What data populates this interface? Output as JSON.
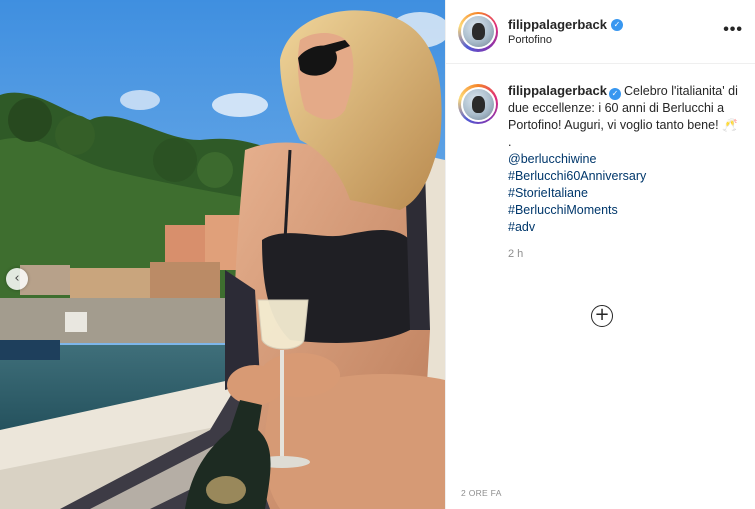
{
  "post": {
    "username": "filippalagerback",
    "location": "Portofino",
    "more_label": "•••",
    "caption": {
      "username": "filippalagerback",
      "text": "Celebro l'italianita' di due eccellenze: i 60 anni di Berlucchi a Portofino! Auguri, vi voglio tanto bene! 🥂",
      "dot": ".",
      "tags": [
        "@berlucchiwine",
        "#Berlucchi60Anniversary",
        "#StorieItaliane",
        "#BerlucchiMoments",
        "#adv"
      ],
      "time": "2 h"
    },
    "plus_label": "+",
    "date_label": "2 ORE FA",
    "nav_prev_label": "‹"
  },
  "icons": {
    "verified": "verified-badge-icon",
    "more": "more-options-icon",
    "plus": "load-more-comments-icon",
    "prev": "chevron-left-icon"
  },
  "colors": {
    "link": "#00376b",
    "verified": "#3897f0",
    "muted": "#8e8e8e"
  }
}
